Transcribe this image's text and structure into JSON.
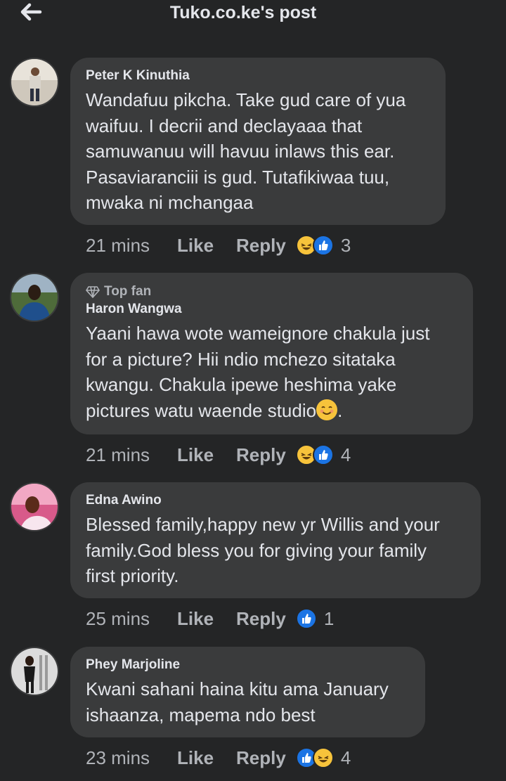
{
  "header": {
    "title": "Tuko.co.ke's post",
    "back_icon": "arrow-left-icon"
  },
  "comments": [
    {
      "name": "Peter K Kinuthia",
      "badge": "",
      "text": "Wandafuu pikcha. Take gud care of yua\nwaifuu. I decrii and declayaaa that\nsamuwanuu will havuu inlaws this ear.\nPasaviaranciii is gud. Tutafikiwaa tuu,\nmwaka ni mchangaa",
      "time": "21 mins",
      "like_label": "Like",
      "reply_label": "Reply",
      "reactions": [
        "haha",
        "like"
      ],
      "reaction_count": "3"
    },
    {
      "name": "Haron Wangwa",
      "badge": "Top fan",
      "text": "Yaani hawa wote wameignore chakula just\nfor a picture? Hii ndio mchezo sitataka\nkwangu. Chakula ipewe heshima yake\npictures watu waende studio",
      "text_end": ".",
      "time": "21 mins",
      "like_label": "Like",
      "reply_label": "Reply",
      "reactions": [
        "haha",
        "like"
      ],
      "reaction_count": "4"
    },
    {
      "name": "Edna Awino",
      "badge": "",
      "text": "Blessed family,happy new yr Willis and your\nfamily.God bless you for giving your family\nfirst priority.",
      "time": "25 mins",
      "like_label": "Like",
      "reply_label": "Reply",
      "reactions": [
        "like"
      ],
      "reaction_count": "1"
    },
    {
      "name": "Phey Marjoline",
      "badge": "",
      "text": "Kwani sahani haina kitu ama January\nishaanza, mapema ndo best",
      "time": "23 mins",
      "like_label": "Like",
      "reply_label": "Reply",
      "reactions": [
        "like",
        "haha"
      ],
      "reaction_count": "4"
    }
  ],
  "colors": {
    "background": "#242526",
    "bubble": "#3a3b3c",
    "primary_text": "#e4e6eb",
    "secondary_text": "#b0b3b8",
    "like_blue": "#1b74e4",
    "haha_yellow": "#f7c33b"
  }
}
